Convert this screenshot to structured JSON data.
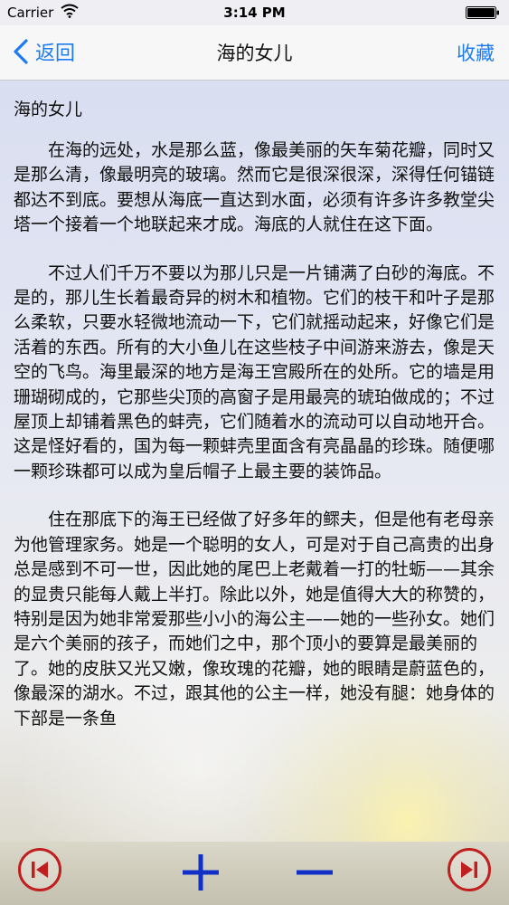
{
  "status_bar": {
    "carrier": "Carrier",
    "time": "3:14 PM"
  },
  "navbar": {
    "back_label": "返回",
    "title": "海的女儿",
    "favorite_label": "收藏"
  },
  "story": {
    "title": "海的女儿",
    "paragraphs": [
      "在海的远处，水是那么蓝，像最美丽的矢车菊花瓣，同时又是那么清，像最明亮的玻璃。然而它是很深很深，深得任何锚链都达不到底。要想从海底一直达到水面，必须有许多许多教堂尖塔一个接着一个地联起来才成。海底的人就住在这下面。",
      "不过人们千万不要以为那儿只是一片铺满了白砂的海底。不是的，那儿生长着最奇异的树木和植物。它们的枝干和叶子是那么柔软，只要水轻微地流动一下，它们就摇动起来，好像它们是活着的东西。所有的大小鱼儿在这些枝子中间游来游去，像是天空的飞鸟。海里最深的地方是海王宫殿所在的处所。它的墙是用珊瑚砌成的，它那些尖顶的高窗子是用最亮的琥珀做成的；不过屋顶上却铺着黑色的蚌壳，它们随着水的流动可以自动地开合。这是怪好看的，国为每一颗蚌壳里面含有亮晶晶的珍珠。随便哪一颗珍珠都可以成为皇后帽子上最主要的装饰品。",
      "住在那底下的海王已经做了好多年的鳏夫，但是他有老母亲为他管理家务。她是一个聪明的女人，可是对于自己高贵的出身总是感到不可一世，因此她的尾巴上老戴着一打的牡蛎——其余的显贵只能每人戴上半打。除此以外，她是值得大大的称赞的，特别是因为她非常爱那些小小的海公主——她的一些孙女。她们是六个美丽的孩子，而她们之中，那个顶小的要算是最美丽的了。她的皮肤又光又嫩，像玫瑰的花瓣，她的眼睛是蔚蓝色的，像最深的湖水。不过，跟其他的公主一样，她没有腿：她身体的下部是一条鱼"
    ]
  },
  "colors": {
    "accent": "#1e7cf2",
    "toolbar_red": "#bf1f1f",
    "toolbar_blue": "#1230c8"
  },
  "icons": {
    "prev": "skip-previous-icon",
    "zoom_in": "plus-icon",
    "zoom_out": "minus-icon",
    "next": "skip-next-icon"
  }
}
